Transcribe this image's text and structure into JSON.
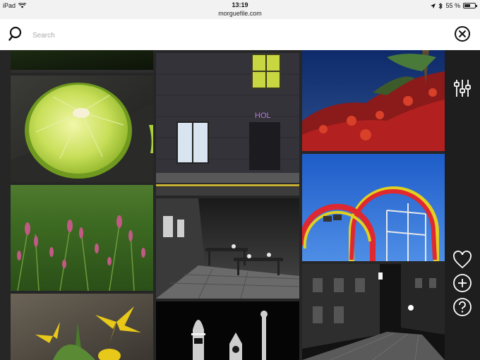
{
  "status_bar": {
    "device": "iPad",
    "time": "13:19",
    "url": "morguefile.com",
    "battery": "55 %",
    "battery_level": 0.55
  },
  "search": {
    "placeholder": "Search",
    "value": ""
  },
  "sidebar": {
    "icons": [
      "sliders-icon",
      "heart-icon",
      "plus-circle-icon",
      "help-circle-icon"
    ]
  },
  "gallery": {
    "photos": [
      "dark-foliage-photo",
      "lime-slice-photo",
      "pink-flowers-grass-photo",
      "yellow-flower-photo",
      "night-building-window-photo",
      "outdoor-cafe-bw-photo",
      "clock-tower-night-photo",
      "red-foliage-lake-photo",
      "roller-coaster-photo",
      "night-street-bw-photo"
    ]
  },
  "colors": {
    "background": "#262626",
    "sidebar": "#1e1e1e",
    "search_bar": "#ffffff",
    "status_bar": "#f2f2f2"
  }
}
